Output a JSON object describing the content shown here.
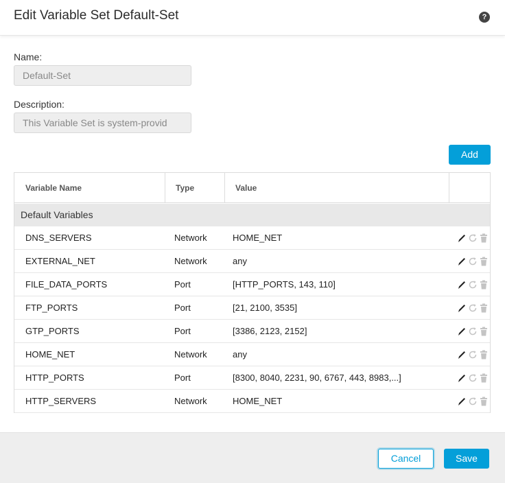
{
  "dialog": {
    "title": "Edit Variable Set Default-Set",
    "help_icon": "question-circle-icon"
  },
  "form": {
    "name_label": "Name:",
    "name_value": "Default-Set",
    "description_label": "Description:",
    "description_value": "This Variable Set is system-provid"
  },
  "toolbar": {
    "add_label": "Add"
  },
  "table": {
    "columns": [
      "Variable Name",
      "Type",
      "Value"
    ],
    "group_label": "Default Variables",
    "rows": [
      {
        "name": "DNS_SERVERS",
        "type": "Network",
        "value": "HOME_NET"
      },
      {
        "name": "EXTERNAL_NET",
        "type": "Network",
        "value": "any"
      },
      {
        "name": "FILE_DATA_PORTS",
        "type": "Port",
        "value": "[HTTP_PORTS, 143, 110]"
      },
      {
        "name": "FTP_PORTS",
        "type": "Port",
        "value": "[21, 2100, 3535]"
      },
      {
        "name": "GTP_PORTS",
        "type": "Port",
        "value": "[3386, 2123, 2152]"
      },
      {
        "name": "HOME_NET",
        "type": "Network",
        "value": "any"
      },
      {
        "name": "HTTP_PORTS",
        "type": "Port",
        "value": "[8300, 8040, 2231, 90, 6767, 443, 8983,...]"
      },
      {
        "name": "HTTP_SERVERS",
        "type": "Network",
        "value": "HOME_NET"
      }
    ],
    "row_actions": [
      "pencil-icon",
      "refresh-icon",
      "trash-icon"
    ]
  },
  "footer": {
    "cancel_label": "Cancel",
    "save_label": "Save"
  },
  "colors": {
    "accent": "#049fd9",
    "footer_bg": "#eeeeee",
    "group_bg": "#e8e8e8"
  }
}
